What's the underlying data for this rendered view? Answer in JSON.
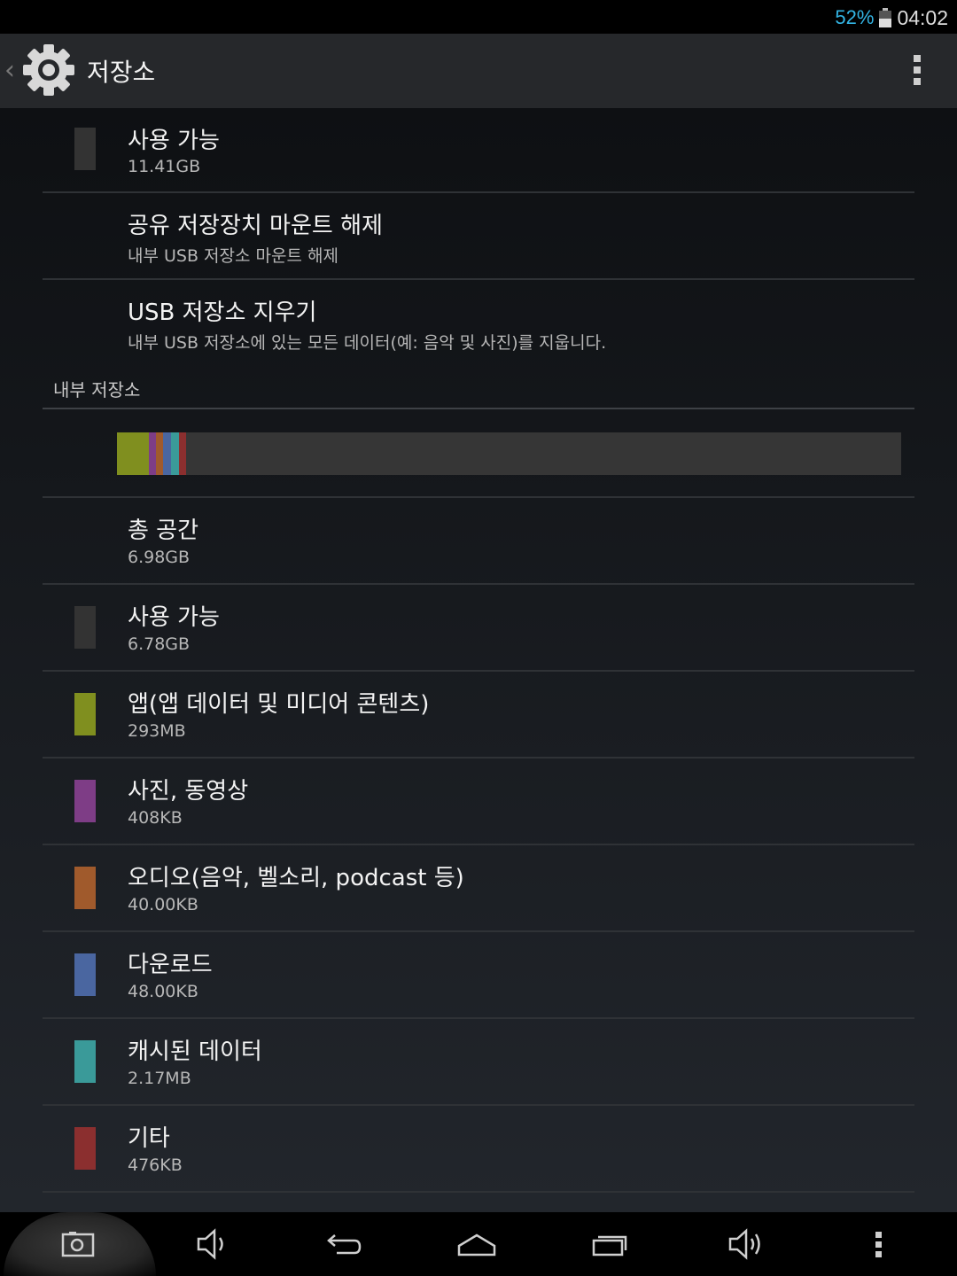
{
  "status_bar": {
    "battery_percent": "52%",
    "time": "04:02",
    "battery_level": 0.52
  },
  "action_bar": {
    "title": "저장소",
    "icon": "settings-gear-icon",
    "overflow_icon": "overflow-menu-icon"
  },
  "top_items": [
    {
      "title": "사용 가능",
      "subtitle": "11.41GB",
      "swatch": "#333333"
    },
    {
      "title": "공유 저장장치 마운트 해제",
      "subtitle": "내부 USB 저장소 마운트 해제"
    },
    {
      "title": "USB 저장소 지우기",
      "subtitle": "내부 USB 저장소에 있는 모든 데이터(예: 음악 및 사진)를 지웁니다."
    }
  ],
  "internal_storage": {
    "header": "내부 저장소",
    "usage_segments": [
      {
        "name": "apps",
        "fraction": 0.041,
        "color": "#808f1f"
      },
      {
        "name": "photos",
        "fraction": 0.009,
        "color": "#7e3d86"
      },
      {
        "name": "audio",
        "fraction": 0.009,
        "color": "#a05a2c"
      },
      {
        "name": "downloads",
        "fraction": 0.01,
        "color": "#4a66a0"
      },
      {
        "name": "cache",
        "fraction": 0.01,
        "color": "#3a9a99"
      },
      {
        "name": "misc",
        "fraction": 0.009,
        "color": "#8b2f2f"
      }
    ],
    "items": [
      {
        "title": "총 공간",
        "subtitle": "6.98GB"
      },
      {
        "title": "사용 가능",
        "subtitle": "6.78GB",
        "swatch": "#333333"
      },
      {
        "title": "앱(앱 데이터 및 미디어 콘텐츠)",
        "subtitle": "293MB",
        "swatch": "#808f1f"
      },
      {
        "title": "사진, 동영상",
        "subtitle": "408KB",
        "swatch": "#7e3d86"
      },
      {
        "title": "오디오(음악, 벨소리, podcast 등)",
        "subtitle": "40.00KB",
        "swatch": "#a05a2c"
      },
      {
        "title": "다운로드",
        "subtitle": "48.00KB",
        "swatch": "#4a66a0"
      },
      {
        "title": "캐시된 데이터",
        "subtitle": "2.17MB",
        "swatch": "#3a9a99"
      },
      {
        "title": "기타",
        "subtitle": "476KB",
        "swatch": "#8b2f2f"
      }
    ]
  },
  "nav_bar": {
    "buttons": [
      "screenshot-icon",
      "volume-down-icon",
      "back-icon",
      "home-icon",
      "recent-apps-icon",
      "volume-up-icon",
      "menu-icon"
    ]
  }
}
